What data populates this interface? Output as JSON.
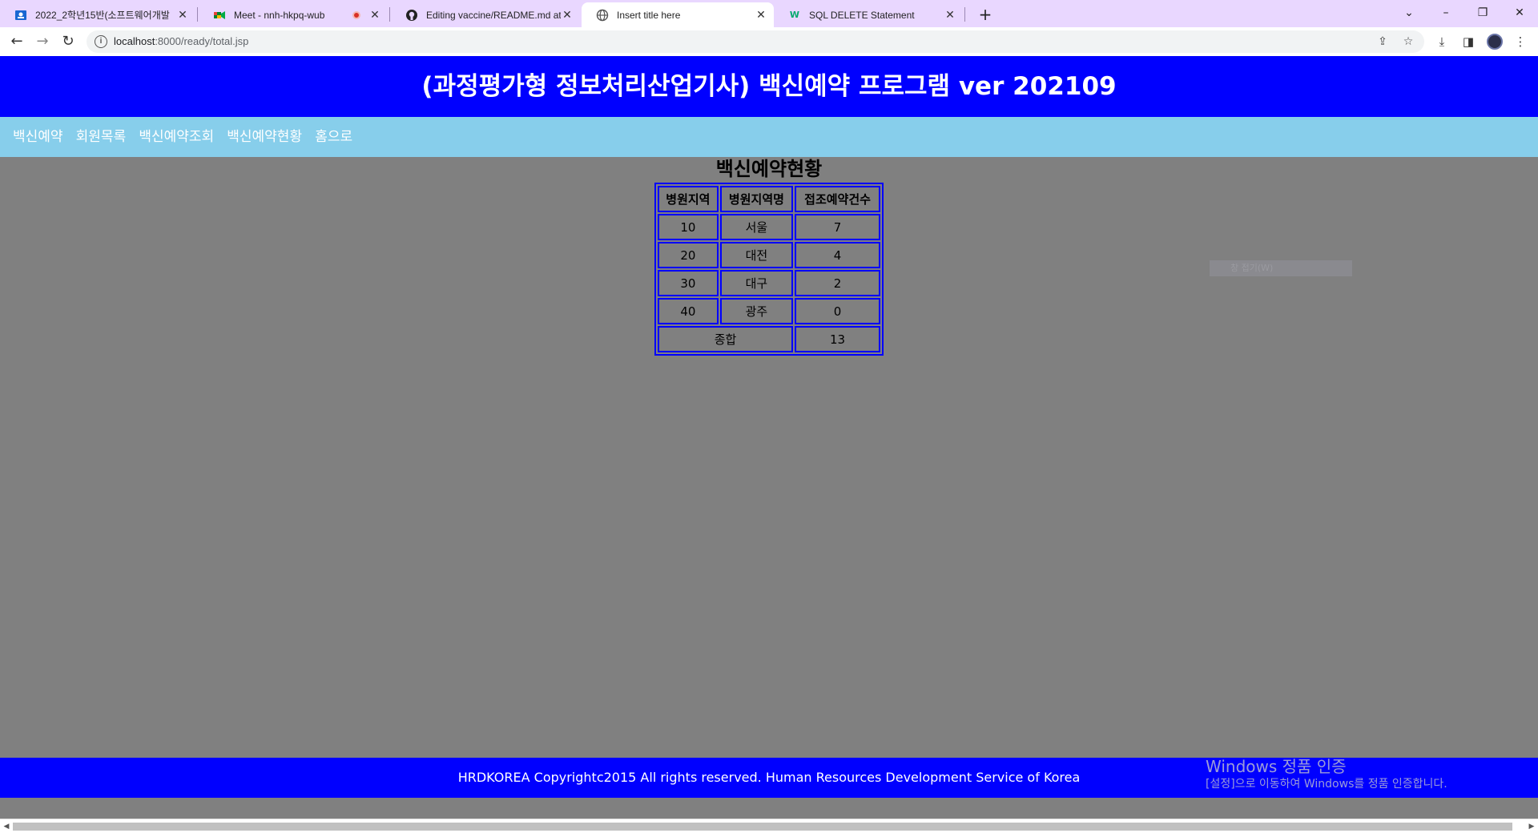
{
  "browser": {
    "tabs": [
      {
        "title": "2022_2학년15반(소프트웨어개발",
        "icon": "classroom-icon"
      },
      {
        "title": "Meet - nnh-hkpq-wub",
        "icon": "meet-icon"
      },
      {
        "title": "Editing vaccine/README.md at",
        "icon": "github-icon"
      },
      {
        "title": "Insert title here",
        "icon": "globe-icon"
      },
      {
        "title": "SQL DELETE Statement",
        "icon": "w3schools-icon"
      }
    ],
    "active_tab": 3,
    "url_host": "localhost",
    "url_path": ":8000/ready/total.jsp"
  },
  "header": {
    "title": "(과정평가형 정보처리산업기사) 백신예약 프로그램 ver 202109"
  },
  "nav": {
    "items": [
      "백신예약",
      "회원목록",
      "백신예약조회",
      "백신예약현황",
      "홈으로"
    ]
  },
  "section": {
    "title": "백신예약현황"
  },
  "table": {
    "headers": [
      "병원지역",
      "병원지역명",
      "접조예약건수"
    ],
    "rows": [
      [
        "10",
        "서울",
        "7"
      ],
      [
        "20",
        "대전",
        "4"
      ],
      [
        "30",
        "대구",
        "2"
      ],
      [
        "40",
        "광주",
        "0"
      ]
    ],
    "total_label": "종합",
    "total_value": "13"
  },
  "overlay": {
    "ghost_text": "창 접기(W)"
  },
  "footer": {
    "text": "HRDKOREA Copyrightc2015 All rights reserved. Human Resources Development Service of Korea"
  },
  "watermark": {
    "line1": "Windows 정품 인증",
    "line2": "[설정]으로 이동하여 Windows를 정품 인증합니다."
  },
  "colors": {
    "header_bg": "#0000ff",
    "nav_bg": "#87ceeb",
    "page_bg": "#808080",
    "tabstrip_bg": "#e9d7ff"
  }
}
